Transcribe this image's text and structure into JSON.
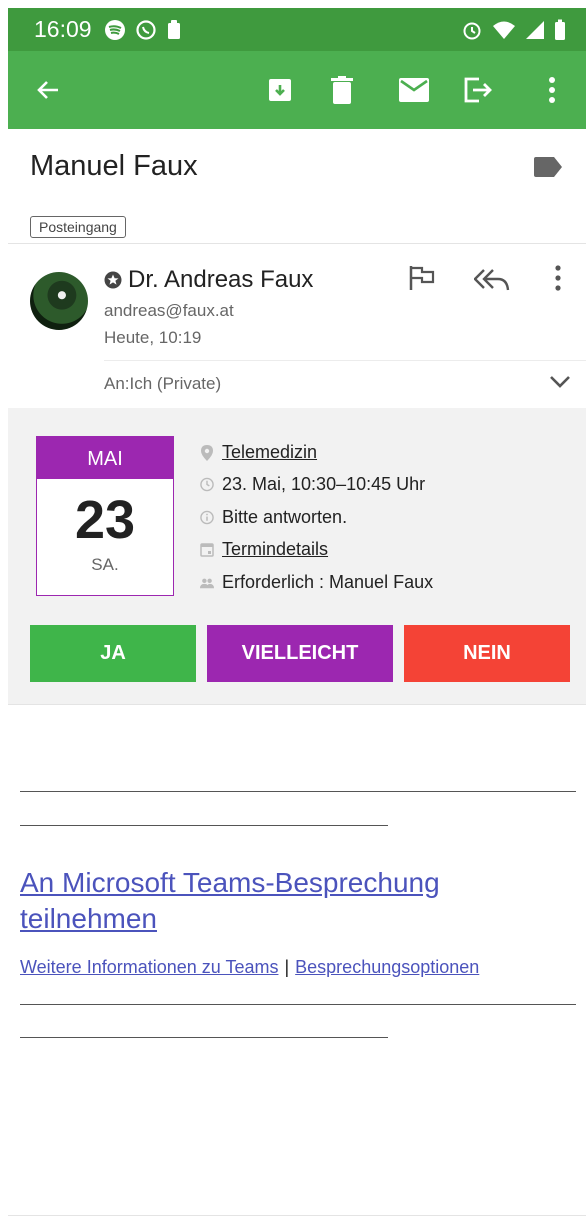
{
  "status_bar": {
    "time": "16:09",
    "icons_left": [
      "spotify-icon",
      "whatsapp-icon",
      "clipboard-icon"
    ],
    "icons_right": [
      "alarm-icon",
      "wifi-icon",
      "signal-icon",
      "battery-icon"
    ]
  },
  "toolbar": {
    "back": "arrow-left-icon",
    "actions": [
      "archive-icon",
      "trash-icon",
      "mail-icon",
      "move-icon",
      "more-vert-icon"
    ],
    "color": "#4caf50"
  },
  "message": {
    "subject": "Manuel Faux",
    "folder": "Posteingang",
    "sender_name": "Dr. Andreas Faux",
    "sender_email": "andreas@faux.at",
    "date": "Heute, 10:19",
    "to_line": "An:Ich (Private)"
  },
  "invite": {
    "month": "MAI",
    "day": "23",
    "weekday": "SA.",
    "location": "Telemedizin",
    "time": "23. Mai, 10:30–10:45 Uhr",
    "reply_request": "Bitte antworten.",
    "details_link": "Termindetails",
    "attendees": "Erforderlich : Manuel Faux",
    "buttons": {
      "yes": "JA",
      "maybe": "VIELLEICHT",
      "no": "NEIN"
    },
    "colors": {
      "yes": "#3fb54a",
      "maybe": "#9c27b0",
      "no": "#f44336"
    }
  },
  "body": {
    "teams_link": "An Microsoft Teams-Besprechung teilnehmen",
    "more_info": "Weitere Informationen zu Teams",
    "separator": "|",
    "meeting_options": "Besprechungsoptionen"
  }
}
